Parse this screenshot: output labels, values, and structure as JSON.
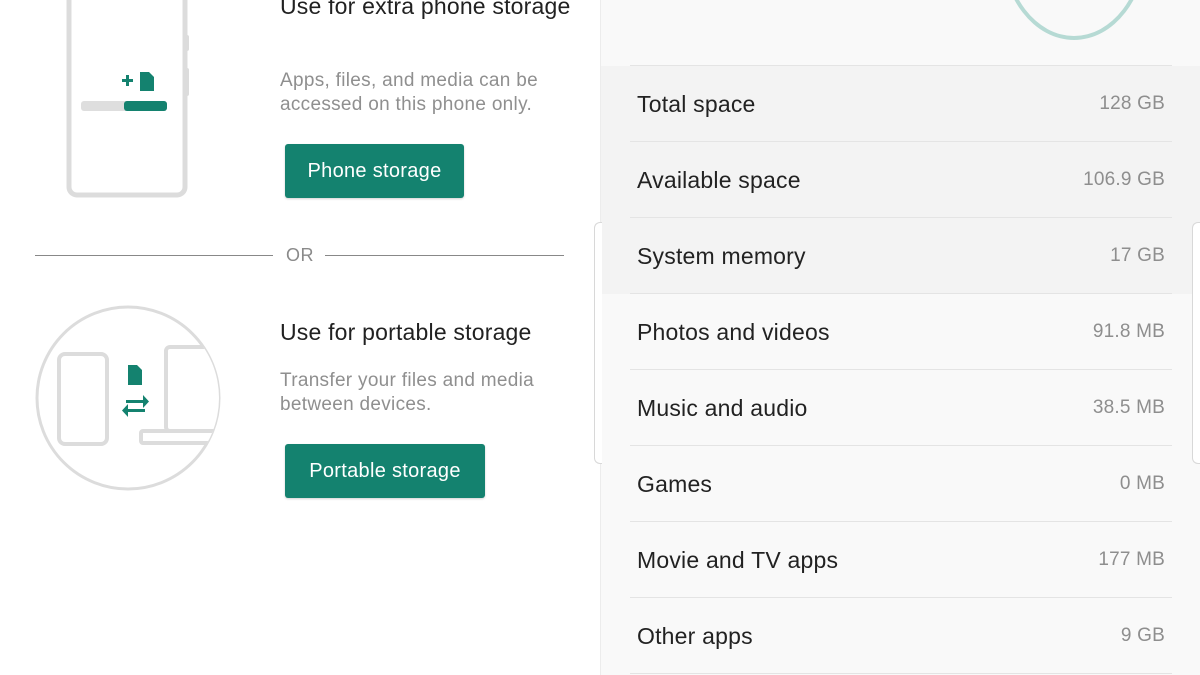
{
  "extra_storage": {
    "title": "Use for extra phone storage",
    "description": "Apps, files, and media can be accessed on this phone only.",
    "button_label": "Phone storage"
  },
  "divider": {
    "or_label": "OR"
  },
  "portable_storage": {
    "title": "Use for portable storage",
    "description": "Transfer your files and media between devices.",
    "button_label": "Portable storage"
  },
  "storage_details": {
    "rows": [
      {
        "label": "Total space",
        "value": "128 GB"
      },
      {
        "label": "Available space",
        "value": "106.9 GB"
      },
      {
        "label": "System memory",
        "value": "17 GB"
      },
      {
        "label": "Photos and videos",
        "value": "91.8 MB"
      },
      {
        "label": "Music and audio",
        "value": "38.5 MB"
      },
      {
        "label": "Games",
        "value": "0 MB"
      },
      {
        "label": "Movie and TV apps",
        "value": "177 MB"
      },
      {
        "label": "Other apps",
        "value": "9 GB"
      }
    ]
  },
  "icons": {
    "add": "plus-icon",
    "sd_card": "sd-card-icon",
    "transfer": "swap-arrows-icon"
  },
  "colors": {
    "accent": "#14826f",
    "ring": "#b6dad4",
    "secondary_text": "#8e8e8e"
  }
}
